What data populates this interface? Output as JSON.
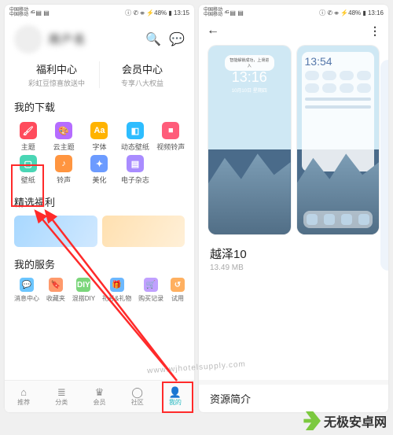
{
  "status_left": {
    "carrier1": "中国移动",
    "carrier2": "中国移动",
    "sig": "⁴ᴳ",
    "icons": "▤ ▤"
  },
  "left_screen": {
    "status_right": "ⓘ ✆ ᚑ ⚡48% ▮ 13:15",
    "user_name": "用户名",
    "centers": [
      {
        "title": "福利中心",
        "sub": "彩虹豆惊喜放送中"
      },
      {
        "title": "会员中心",
        "sub": "专享八大权益"
      }
    ],
    "downloads_title": "我的下载",
    "grid1": [
      {
        "label": "主题",
        "icon": "🖌",
        "bg": "#ff4b5c"
      },
      {
        "label": "云主题",
        "icon": "🎨",
        "bg": "#b56cff"
      },
      {
        "label": "字体",
        "icon": "Aa",
        "bg": "#ffb300"
      },
      {
        "label": "动态壁纸",
        "icon": "◧",
        "bg": "#2dbdff"
      },
      {
        "label": "视频铃声",
        "icon": "■",
        "bg": "#ff5c7a"
      },
      {
        "label": "壁纸",
        "icon": "▢",
        "bg": "#4ad6b5"
      },
      {
        "label": "铃声",
        "icon": "♪",
        "bg": "#ff9540"
      },
      {
        "label": "美化",
        "icon": "✦",
        "bg": "#6c9bff"
      },
      {
        "label": "电子杂志",
        "icon": "▤",
        "bg": "#a98cff"
      }
    ],
    "featured_title": "精选福利",
    "services_title": "我的服务",
    "services": [
      {
        "label": "消息中心",
        "icon": "💬",
        "bg": "#6cc6ff"
      },
      {
        "label": "收藏夹",
        "icon": "🔖",
        "bg": "#ff9a6c"
      },
      {
        "label": "混搭DIY",
        "icon": "DIY",
        "bg": "#7bd67b"
      },
      {
        "label": "礼券&礼物",
        "icon": "🎁",
        "bg": "#6cb8ff"
      },
      {
        "label": "购买记录",
        "icon": "🛒",
        "bg": "#c0a0ff"
      },
      {
        "label": "试用",
        "icon": "↺",
        "bg": "#ffb060"
      }
    ],
    "tabs": [
      {
        "label": "推荐"
      },
      {
        "label": "分类"
      },
      {
        "label": "会员"
      },
      {
        "label": "社区"
      },
      {
        "label": "我的"
      }
    ]
  },
  "right_screen": {
    "status_right": "ⓘ ✆ ᚑ ⚡48% ▮ 13:16",
    "preview1": {
      "time": "13:16",
      "date": "10月10日 星期四",
      "bubble": "智能解锁成功，上滑进入"
    },
    "preview2": {
      "time": "13:54"
    },
    "theme_name": "越泽10",
    "theme_size": "13.49 MB",
    "resource_title": "资源简介"
  },
  "watermark": {
    "text": "无极安卓网",
    "url": "www.wjhotelsupply.com"
  }
}
